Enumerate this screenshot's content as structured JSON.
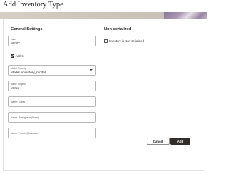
{
  "dialog": {
    "title": "Add Inventory Type"
  },
  "general": {
    "heading": "General Settings",
    "label_field": {
      "label": "Label",
      "value": "MERT"
    },
    "active": {
      "label": "Active",
      "checked": true
    },
    "model_property": {
      "label": "Model Property",
      "value": "Model [inventory_model]"
    },
    "name_english": {
      "label": "Name: English",
      "value": "Meter"
    },
    "name_greek": {
      "placeholder": "Name: Greek"
    },
    "name_portuguese": {
      "placeholder": "Name: Portuguese (Brazil)"
    },
    "name_french": {
      "placeholder": "Name: French (European)"
    }
  },
  "non_serialized": {
    "heading": "Non-serialized",
    "checkbox": {
      "label": "Inventory is Non-serialized",
      "checked": false
    }
  },
  "actions": {
    "cancel_label": "Cancel",
    "add_label": "Add"
  }
}
